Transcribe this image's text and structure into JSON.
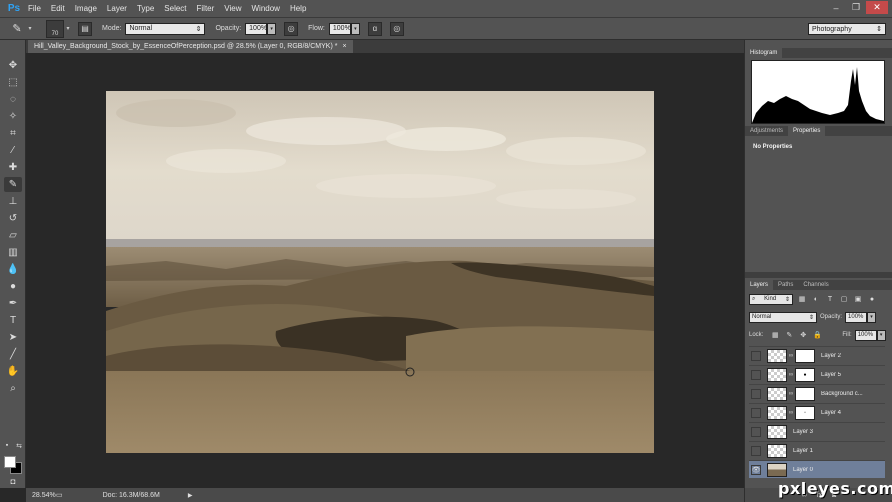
{
  "app": {
    "logo": "Ps"
  },
  "menu": [
    "File",
    "Edit",
    "Image",
    "Layer",
    "Type",
    "Select",
    "Filter",
    "View",
    "Window",
    "Help"
  ],
  "window_controls": {
    "min": "–",
    "max": "❐",
    "close": "✕"
  },
  "options": {
    "brush_size": "70",
    "mode_label": "Mode:",
    "mode_value": "Normal",
    "opacity_label": "Opacity:",
    "opacity_value": "100%",
    "flow_label": "Flow:",
    "flow_value": "100%",
    "workspace": "Photography"
  },
  "document": {
    "tab_title": "Hill_Valley_Background_Stock_by_EssenceOfPerception.psd @ 28.5% (Layer 0, RGB/8/CMYK) *",
    "tab_close": "×"
  },
  "status": {
    "zoom": "28.54%",
    "doc_info": "Doc: 16.3M/68.6M",
    "arrow": "▶"
  },
  "panels": {
    "histogram_tab": "Histogram",
    "adjustments_tab": "Adjustments",
    "properties_tab": "Properties",
    "properties_text": "No Properties",
    "layers_tab": "Layers",
    "paths_tab": "Paths",
    "channels_tab": "Channels"
  },
  "layers_panel": {
    "filter_kind": "Kind",
    "blend_mode": "Normal",
    "opacity_label": "Opacity:",
    "opacity_value": "100%",
    "lock_label": "Lock:",
    "fill_label": "Fill:",
    "fill_value": "100%",
    "layers": [
      {
        "name": "Layer 2",
        "mask": true,
        "mask_mark": ""
      },
      {
        "name": "Layer 5",
        "mask": true,
        "mask_mark": "●"
      },
      {
        "name": "Background c...",
        "mask": true,
        "mask_mark": ""
      },
      {
        "name": "Layer 4",
        "mask": true,
        "mask_mark": "▫"
      },
      {
        "name": "Layer 3",
        "mask": false
      },
      {
        "name": "Layer 1",
        "mask": false
      },
      {
        "name": "Layer 0",
        "mask": false,
        "selected": true,
        "visible": true
      }
    ]
  },
  "watermark": "pxleyes.com"
}
